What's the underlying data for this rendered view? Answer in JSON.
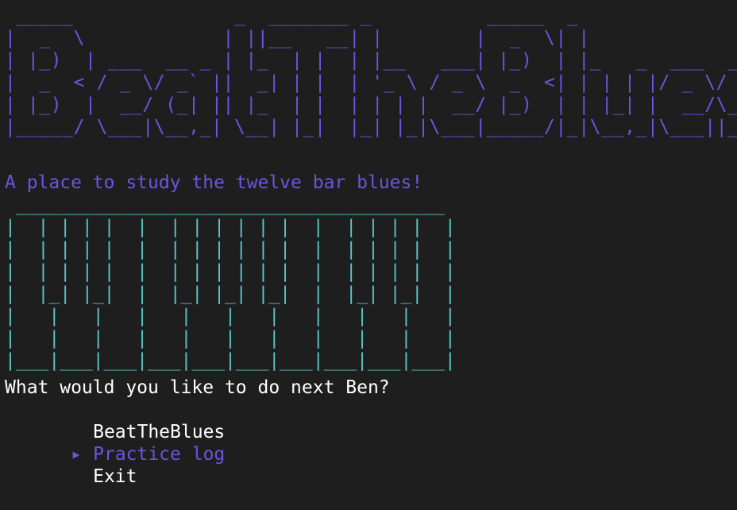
{
  "banner_art": " _____              _  _______ _          _____  _\n|  _  \\            | ||__   __| |        |  _  \\| |\n| |_)  | ___  __ _ | |_  | |  | |__   ___| |_)  | |_   _  ___  ___\n|  _  < / _ \\/ _` ||  _| | |  | '_ \\ / _ \\  _  <| | | | |/ _ \\/ __|\n| |_)  |  __/ (_| || |_  | |  | | | |  __/ |_)  | | |_| |  __/\\__ \\\n|_____/ \\___|\\__,_| \\__| |_|  |_| |_|\\___|_____/|_|\\__,_|\\___||___/",
  "tagline": "A place to study the twelve bar blues!",
  "piano_art": " _______________________________________\n|  | | | |  |  | | | | | |  |  | | | |  |\n|  | | | |  |  | | | | | |  |  | | | |  |\n|  | | | |  |  | | | | | |  |  | | | |  |\n|  |_| |_|  |  |_| |_| |_|  |  |_| |_|  |\n|   |   |   |   |   |   |   |   |   |   |\n|   |   |   |   |   |   |   |   |   |   |\n|___|___|___|___|___|___|___|___|___|___|",
  "prompt": "What would you like to do next Ben?",
  "pointer": "▸",
  "menu": [
    {
      "label": "BeatTheBlues",
      "selected": false
    },
    {
      "label": "Practice log",
      "selected": true
    },
    {
      "label": "Exit",
      "selected": false
    }
  ],
  "colors": {
    "background": "#1e1e1e",
    "accent": "#6b55e0",
    "piano": "#58c3c4",
    "text": "#ffffff"
  }
}
